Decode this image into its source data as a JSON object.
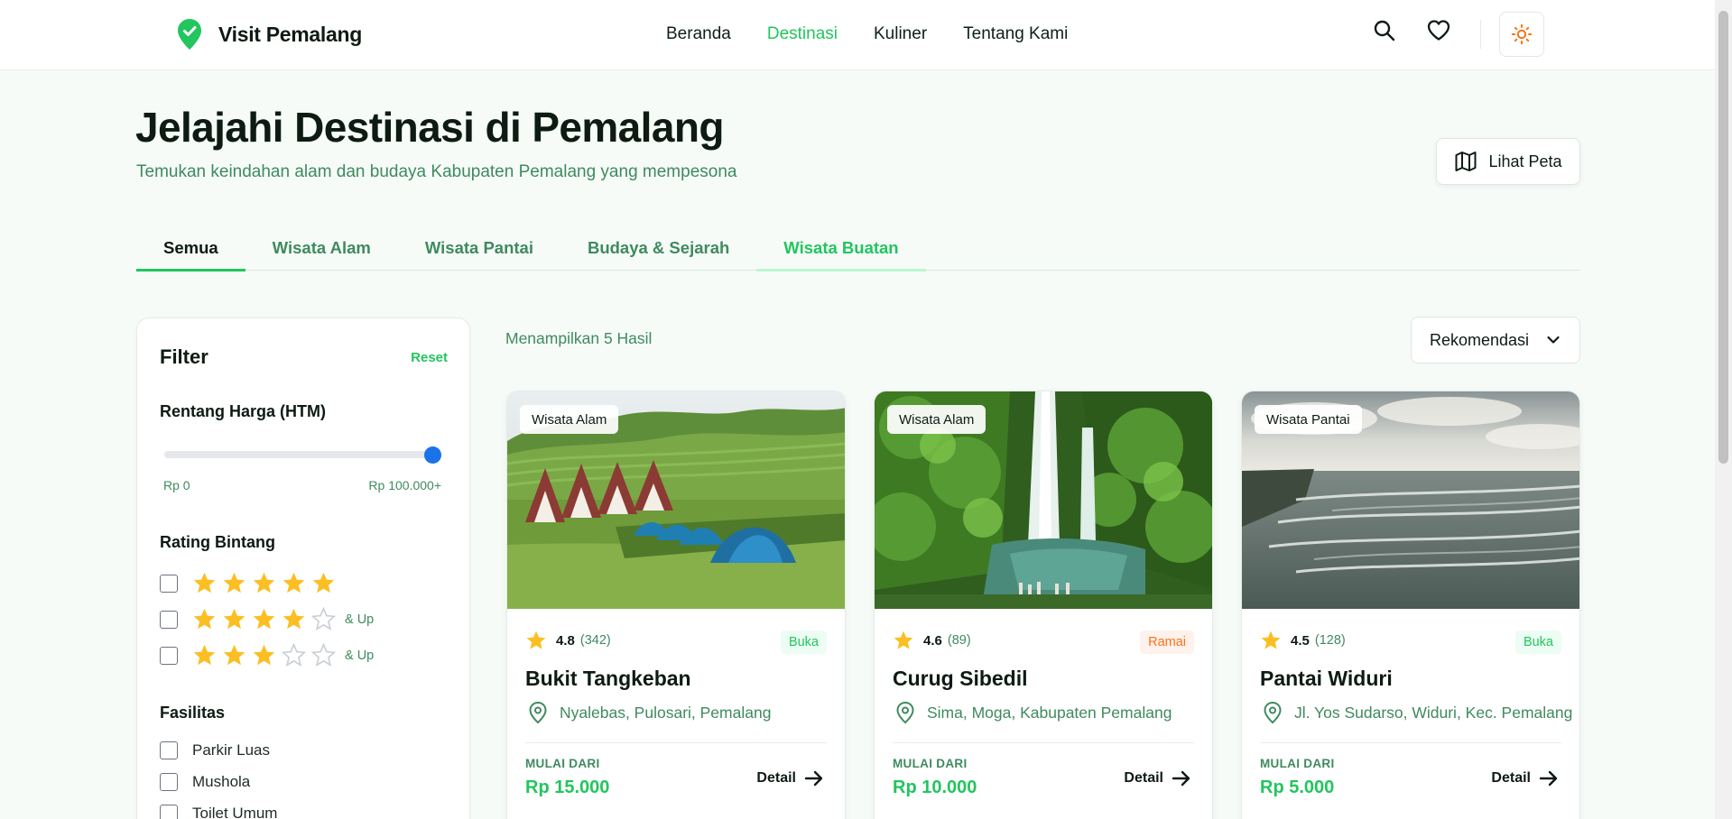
{
  "brand": {
    "name": "Visit Pemalang",
    "logo_icon": "map-pin-check-icon",
    "color": "#22c55e"
  },
  "nav": {
    "links": [
      {
        "label": "Beranda",
        "active": false
      },
      {
        "label": "Destinasi",
        "active": true
      },
      {
        "label": "Kuliner",
        "active": false
      },
      {
        "label": "Tentang Kami",
        "active": false
      }
    ],
    "icons": [
      "search-icon",
      "heart-icon",
      "sun-icon"
    ]
  },
  "header": {
    "title": "Jelajahi Destinasi di Pemalang",
    "subtitle": "Temukan keindahan alam dan budaya Kabupaten Pemalang yang mempesona",
    "map_button": "Lihat Peta"
  },
  "tabs": [
    {
      "label": "Semua",
      "selected": true
    },
    {
      "label": "Wisata Alam",
      "selected": false
    },
    {
      "label": "Wisata Pantai",
      "selected": false
    },
    {
      "label": "Budaya & Sejarah",
      "selected": false
    },
    {
      "label": "Wisata Buatan",
      "selected": false
    }
  ],
  "filter": {
    "title": "Filter",
    "reset": "Reset",
    "price": {
      "label": "Rentang Harga (HTM)",
      "min_label": "Rp 0",
      "max_label": "Rp 100.000+",
      "value_fraction": 1.0
    },
    "rating": {
      "label": "Rating Bintang",
      "options": [
        {
          "stars": 5,
          "suffix": ""
        },
        {
          "stars": 4,
          "suffix": "& Up"
        },
        {
          "stars": 3,
          "suffix": "& Up"
        }
      ]
    },
    "facilities": {
      "label": "Fasilitas",
      "options": [
        "Parkir Luas",
        "Mushola",
        "Toilet Umum"
      ]
    }
  },
  "results": {
    "count_text": "Menampilkan 5 Hasil",
    "sort_label": "Rekomendasi"
  },
  "cards": [
    {
      "category": "Wisata Alam",
      "rating": "4.8",
      "reviews": "(342)",
      "status": "Buka",
      "name": "Bukit Tangkeban",
      "location": "Nyalebas, Pulosari, Pemalang",
      "price_label": "MULAI DARI",
      "price": "Rp 15.000",
      "detail": "Detail"
    },
    {
      "category": "Wisata Alam",
      "rating": "4.6",
      "reviews": "(89)",
      "status": "Ramai",
      "name": "Curug Sibedil",
      "location": "Sima, Moga, Kabupaten Pemalang",
      "price_label": "MULAI DARI",
      "price": "Rp 10.000",
      "detail": "Detail"
    },
    {
      "category": "Wisata Pantai",
      "rating": "4.5",
      "reviews": "(128)",
      "status": "Buka",
      "name": "Pantai Widuri",
      "location": "Jl. Yos Sudarso, Widuri, Kec. Pemalang",
      "price_label": "MULAI DARI",
      "price": "Rp 5.000",
      "detail": "Detail"
    }
  ]
}
